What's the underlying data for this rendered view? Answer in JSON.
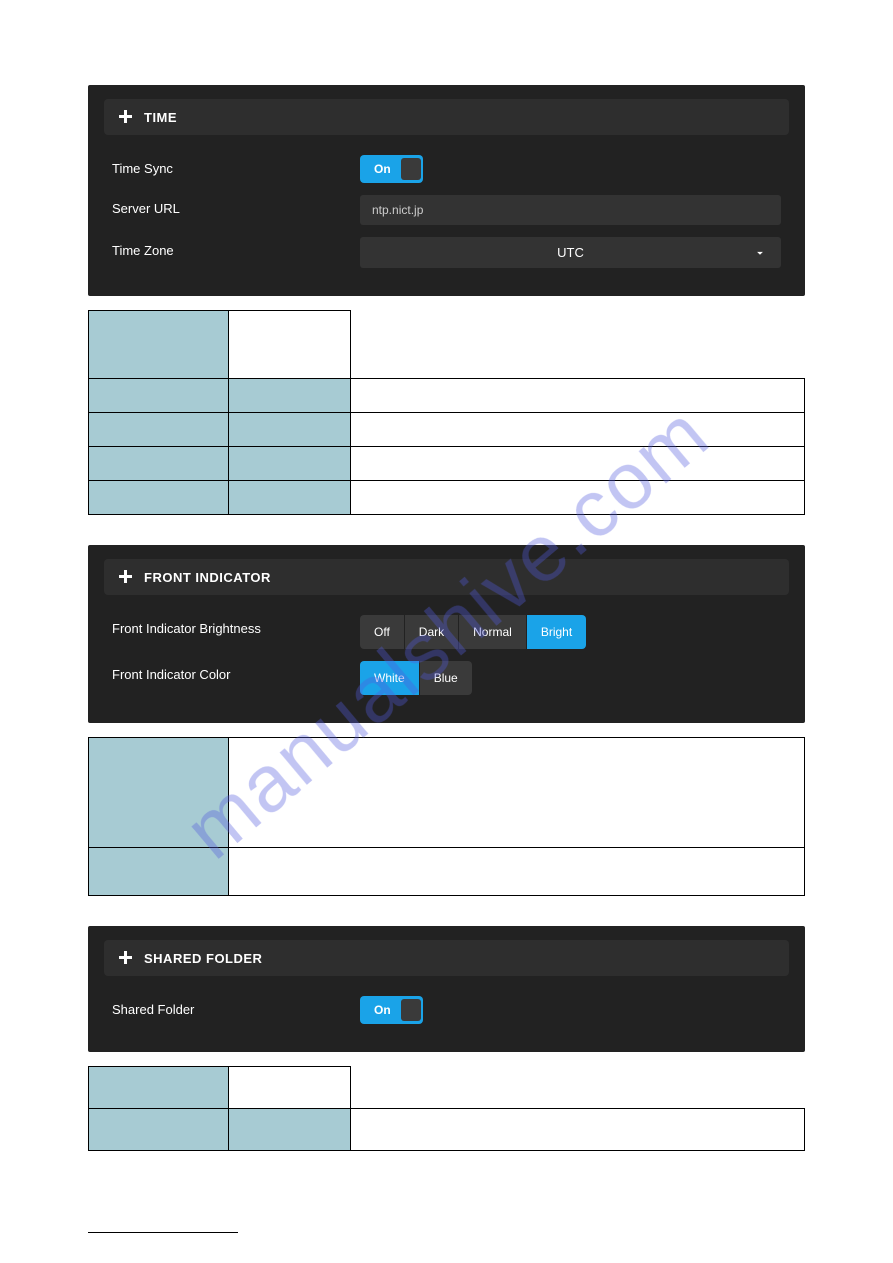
{
  "watermark": "manualshive.com",
  "time_panel": {
    "title": "TIME",
    "sync_label": "Time Sync",
    "sync_value": "On",
    "server_label": "Server URL",
    "server_value": "ntp.nict.jp",
    "tz_label": "Time Zone",
    "tz_value": "UTC"
  },
  "indicator_panel": {
    "title": "FRONT INDICATOR",
    "brightness_label": "Front Indicator Brightness",
    "brightness_options": {
      "off": "Off",
      "dark": "Dark",
      "normal": "Normal",
      "bright": "Bright"
    },
    "color_label": "Front Indicator Color",
    "color_options": {
      "white": "White",
      "blue": "Blue"
    }
  },
  "shared_panel": {
    "title": "SHARED FOLDER",
    "label": "Shared Folder",
    "value": "On"
  }
}
